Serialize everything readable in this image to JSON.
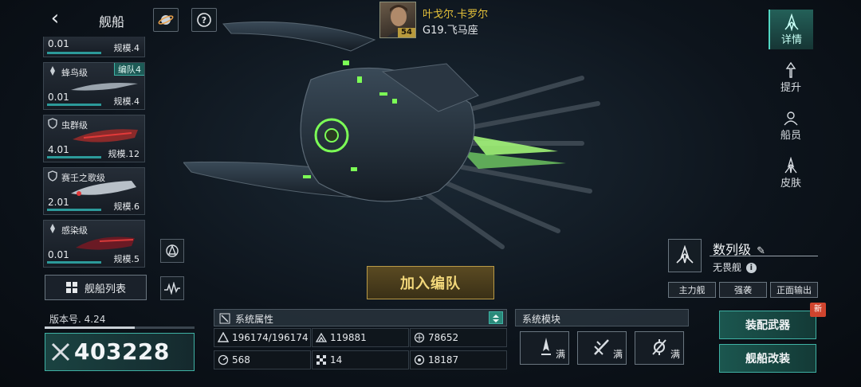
{
  "header": {
    "title": "舰船"
  },
  "commander": {
    "name": "叶戈尔.卡罗尔",
    "level": "54",
    "location": "G19.飞马座"
  },
  "ship_list": [
    {
      "class": "",
      "value": "0.01",
      "scale": "规模.4",
      "badge": ""
    },
    {
      "class": "蜂鸟级",
      "value": "0.01",
      "scale": "规模.4",
      "badge": "编队4"
    },
    {
      "class": "虫群级",
      "value": "4.01",
      "scale": "规模.12",
      "badge": ""
    },
    {
      "class": "赛壬之歌级",
      "value": "2.01",
      "scale": "规模.6",
      "badge": ""
    },
    {
      "class": "感染级",
      "value": "0.01",
      "scale": "规模.5",
      "badge": ""
    }
  ],
  "fleet_list_label": "舰船列表",
  "version": {
    "label": "版本号. 4.24",
    "progress": 0.6
  },
  "power": {
    "value": "403228"
  },
  "join_button": "加入编队",
  "system_attributes": {
    "title": "系统属性",
    "cells": [
      {
        "icon": "shield-icon",
        "value": "196174/196174"
      },
      {
        "icon": "armor-icon",
        "value": "119881"
      },
      {
        "icon": "defense-icon",
        "value": "78652"
      },
      {
        "icon": "speed-icon",
        "value": "568"
      },
      {
        "icon": "flag-icon",
        "value": "14"
      },
      {
        "icon": "target-icon",
        "value": "18187"
      }
    ]
  },
  "system_modules": {
    "title": "系统模块",
    "slots": [
      {
        "icon": "module-ship-icon",
        "status": "满"
      },
      {
        "icon": "module-missile-icon",
        "status": "满"
      },
      {
        "icon": "module-gear-icon",
        "status": "满"
      }
    ]
  },
  "ship_info": {
    "class_name": "数列级",
    "type": "无畏舰",
    "tags": [
      "主力舰",
      "强袭",
      "正面输出"
    ]
  },
  "actions": {
    "equip": "装配武器",
    "modify": "舰船改装",
    "new_badge": "新"
  },
  "side_tabs": [
    {
      "label": "详情",
      "active": true
    },
    {
      "label": "提升",
      "active": false
    },
    {
      "label": "船员",
      "active": false
    },
    {
      "label": "皮肤",
      "active": false
    }
  ],
  "colors": {
    "accent": "#3fb1a4",
    "gold": "#e6c23a",
    "new": "#d0442e"
  }
}
